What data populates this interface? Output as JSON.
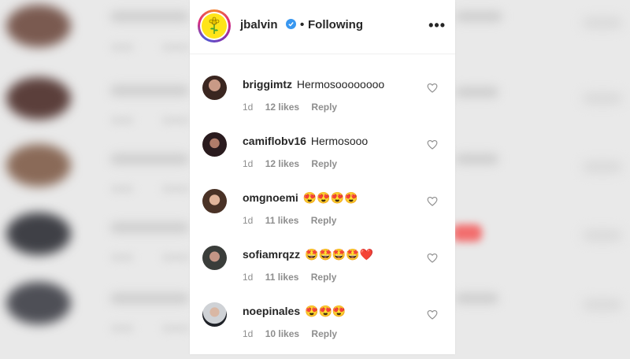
{
  "header": {
    "username": "jbalvin",
    "separator": "•",
    "follow_status": "Following",
    "more_icon": "more-horizontal-icon",
    "verified_icon": "verified-badge-icon",
    "avatar_color": "#ffe419"
  },
  "comments": [
    {
      "user": "briggimtz",
      "text": "Hermosoooooooo",
      "time": "1d",
      "likes": "12 likes",
      "reply": "Reply"
    },
    {
      "user": "camiflobv16",
      "text": "Hermosooo",
      "time": "1d",
      "likes": "12 likes",
      "reply": "Reply"
    },
    {
      "user": "omgnoemi",
      "text": "😍😍😍😍",
      "time": "1d",
      "likes": "11 likes",
      "reply": "Reply"
    },
    {
      "user": "sofiamrqzz",
      "text": "🤩🤩🤩🤩❤️",
      "time": "1d",
      "likes": "11 likes",
      "reply": "Reply"
    },
    {
      "user": "noepinales",
      "text": "😍😍😍",
      "time": "1d",
      "likes": "10 likes",
      "reply": "Reply"
    }
  ],
  "colors": {
    "verified": "#3897f0",
    "meta_text": "#8e8e8e",
    "text": "#262626"
  }
}
